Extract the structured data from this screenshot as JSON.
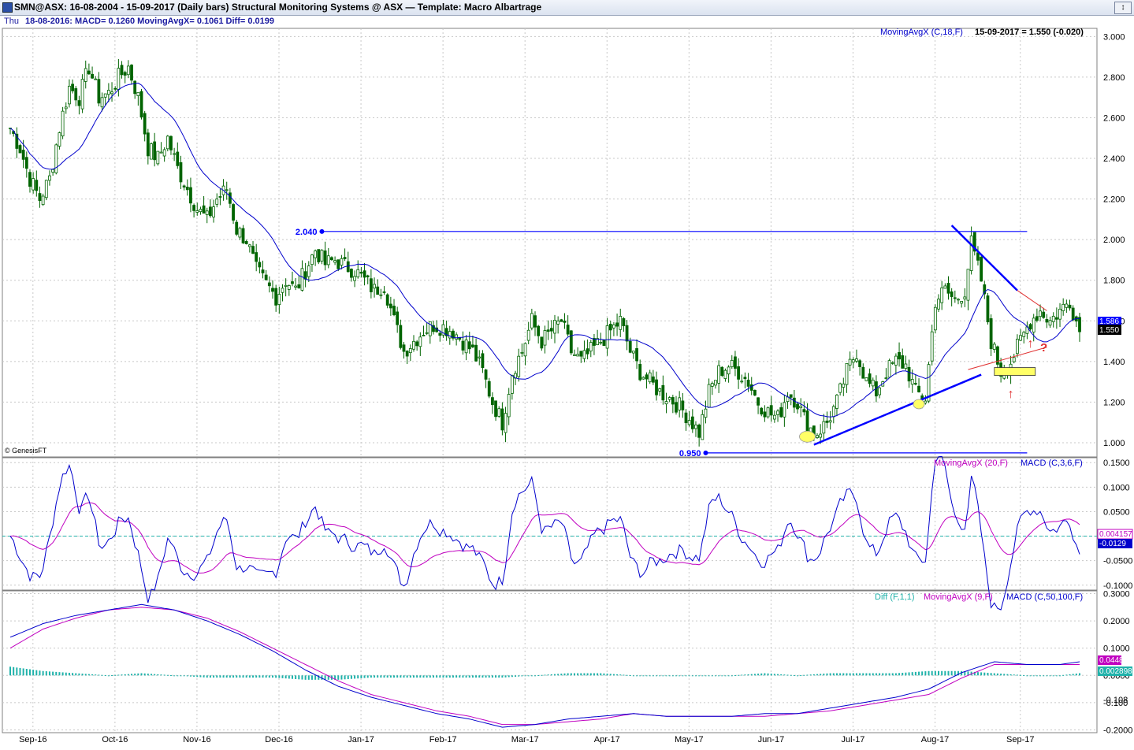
{
  "window": {
    "title": "SMN@ASX:  16-08-2004 - 15-09-2017  (Daily bars)   Structural Monitoring Systems @ ASX  —  Template: Macro Albartrage",
    "close_glyph": "↕"
  },
  "infobar": {
    "day": "Thu",
    "values": "18-08-2016:  MACD= 0.1260  MovingAvgX= 0.1061  Diff= 0.0199"
  },
  "colors": {
    "candle": "#006400",
    "ma": "#0000cc",
    "signal": "#c000c0",
    "diff": "#20b2aa",
    "trend": "#0000ff",
    "resistance": "#e03030",
    "axis_text": "#000000",
    "grid": "#c8c8c8",
    "highlight": "#ffff66"
  },
  "chart_data": [
    {
      "type": "candlestick",
      "panel": "price",
      "legend": [
        "MovingAvgX (C,18,F)",
        "15-09-2017 = 1.550 (-0.020)"
      ],
      "yticks": [
        "3.000",
        "2.800",
        "2.600",
        "2.400",
        "2.200",
        "2.000",
        "1.800",
        "1.600",
        "1.400",
        "1.200",
        "1.000"
      ],
      "ylim": [
        0.93,
        3.04
      ],
      "x_labels": [
        "Sep-16",
        "Oct-16",
        "Nov-16",
        "Dec-16",
        "Jan-17",
        "Feb-17",
        "Mar-17",
        "Apr-17",
        "May-17",
        "Jun-17",
        "Jul-17",
        "Aug-17",
        "Sep-17"
      ],
      "price_tags": [
        "1.586",
        "1.550"
      ],
      "annotations": {
        "high_label": "2.040",
        "low_label": "0.950",
        "question": "?",
        "watermark": "© GenesisFT"
      },
      "levels": {
        "high": 2.04,
        "low": 0.95
      },
      "trendlines": [
        {
          "name": "support",
          "from": [
            245,
            0.99
          ],
          "to": [
            296,
            1.335
          ]
        },
        {
          "name": "falling-resistance",
          "from": [
            287,
            2.07
          ],
          "to": [
            307,
            1.75
          ]
        },
        {
          "name": "red-resistance",
          "from": [
            307,
            1.75
          ],
          "to": [
            316,
            1.65
          ]
        },
        {
          "name": "red-support",
          "from": [
            292,
            1.36
          ],
          "to": [
            316,
            1.47
          ]
        }
      ],
      "close_path": [
        [
          0,
          2.55
        ],
        [
          3,
          2.45
        ],
        [
          6,
          2.3
        ],
        [
          9,
          2.2
        ],
        [
          12,
          2.3
        ],
        [
          15,
          2.55
        ],
        [
          18,
          2.75
        ],
        [
          21,
          2.7
        ],
        [
          24,
          2.85
        ],
        [
          27,
          2.7
        ],
        [
          30,
          2.72
        ],
        [
          33,
          2.8
        ],
        [
          36,
          2.85
        ],
        [
          39,
          2.7
        ],
        [
          42,
          2.45
        ],
        [
          45,
          2.4
        ],
        [
          48,
          2.5
        ],
        [
          51,
          2.35
        ],
        [
          54,
          2.25
        ],
        [
          57,
          2.15
        ],
        [
          60,
          2.1
        ],
        [
          63,
          2.2
        ],
        [
          66,
          2.25
        ],
        [
          69,
          2.05
        ],
        [
          72,
          2.0
        ],
        [
          75,
          1.85
        ],
        [
          78,
          1.78
        ],
        [
          81,
          1.72
        ],
        [
          84,
          1.8
        ],
        [
          87,
          1.75
        ],
        [
          90,
          1.85
        ],
        [
          93,
          1.95
        ],
        [
          96,
          1.88
        ],
        [
          99,
          1.9
        ],
        [
          102,
          1.87
        ],
        [
          105,
          1.85
        ],
        [
          108,
          1.8
        ],
        [
          111,
          1.75
        ],
        [
          114,
          1.78
        ],
        [
          117,
          1.6
        ],
        [
          120,
          1.45
        ],
        [
          123,
          1.5
        ],
        [
          126,
          1.55
        ],
        [
          129,
          1.58
        ],
        [
          132,
          1.57
        ],
        [
          135,
          1.55
        ],
        [
          138,
          1.5
        ],
        [
          141,
          1.45
        ],
        [
          144,
          1.35
        ],
        [
          147,
          1.2
        ],
        [
          150,
          1.1
        ],
        [
          153,
          1.35
        ],
        [
          156,
          1.45
        ],
        [
          159,
          1.6
        ],
        [
          162,
          1.5
        ],
        [
          165,
          1.55
        ],
        [
          168,
          1.6
        ],
        [
          171,
          1.45
        ],
        [
          174,
          1.4
        ],
        [
          177,
          1.45
        ],
        [
          180,
          1.5
        ],
        [
          183,
          1.55
        ],
        [
          186,
          1.6
        ],
        [
          189,
          1.45
        ],
        [
          192,
          1.35
        ],
        [
          195,
          1.3
        ],
        [
          198,
          1.25
        ],
        [
          201,
          1.22
        ],
        [
          204,
          1.18
        ],
        [
          207,
          1.12
        ],
        [
          210,
          1.05
        ],
        [
          213,
          1.25
        ],
        [
          216,
          1.35
        ],
        [
          219,
          1.38
        ],
        [
          222,
          1.35
        ],
        [
          225,
          1.3
        ],
        [
          228,
          1.2
        ],
        [
          231,
          1.15
        ],
        [
          234,
          1.12
        ],
        [
          237,
          1.25
        ],
        [
          240,
          1.2
        ],
        [
          243,
          1.08
        ],
        [
          246,
          1.05
        ],
        [
          249,
          1.1
        ],
        [
          252,
          1.2
        ],
        [
          255,
          1.35
        ],
        [
          258,
          1.45
        ],
        [
          261,
          1.3
        ],
        [
          264,
          1.25
        ],
        [
          267,
          1.35
        ],
        [
          270,
          1.4
        ],
        [
          273,
          1.38
        ],
        [
          276,
          1.25
        ],
        [
          279,
          1.22
        ],
        [
          282,
          1.7
        ],
        [
          285,
          1.75
        ],
        [
          288,
          1.7
        ],
        [
          291,
          1.75
        ],
        [
          293,
          1.98
        ],
        [
          296,
          1.8
        ],
        [
          299,
          1.5
        ],
        [
          302,
          1.35
        ],
        [
          305,
          1.4
        ],
        [
          308,
          1.5
        ],
        [
          311,
          1.6
        ],
        [
          314,
          1.65
        ],
        [
          317,
          1.6
        ],
        [
          320,
          1.65
        ],
        [
          323,
          1.7
        ],
        [
          326,
          1.55
        ]
      ]
    },
    {
      "type": "line",
      "panel": "macd-fast",
      "legend": [
        "MovingAvgX (20,F)",
        "MACD (C,3,6,F)"
      ],
      "yticks": [
        "0.1500",
        "0.1000",
        "0.0500",
        "0.0000",
        "-0.0500",
        "-0.1000"
      ],
      "ylim": [
        -0.11,
        0.16
      ],
      "tags": [
        "0.004157",
        "-0.0129"
      ],
      "zero_line": 0.0
    },
    {
      "type": "line",
      "panel": "macd-slow",
      "legend": [
        "Diff (F,1,1)",
        "MovingAvgX (9,F)",
        "MACD (C,50,100,F)"
      ],
      "yticks": [
        "0.3000",
        "0.2000",
        "0.1000",
        "0.0000",
        "-0.100",
        "-0.2000"
      ],
      "ylim": [
        -0.21,
        0.31
      ],
      "tags": [
        "0.0448",
        "0.002898",
        "-0.108"
      ],
      "macd_path": [
        [
          0,
          0.14
        ],
        [
          10,
          0.19
        ],
        [
          20,
          0.22
        ],
        [
          30,
          0.24
        ],
        [
          40,
          0.26
        ],
        [
          50,
          0.24
        ],
        [
          60,
          0.2
        ],
        [
          70,
          0.15
        ],
        [
          80,
          0.09
        ],
        [
          90,
          0.02
        ],
        [
          100,
          -0.04
        ],
        [
          110,
          -0.08
        ],
        [
          120,
          -0.11
        ],
        [
          130,
          -0.14
        ],
        [
          140,
          -0.16
        ],
        [
          150,
          -0.19
        ],
        [
          160,
          -0.18
        ],
        [
          170,
          -0.16
        ],
        [
          180,
          -0.15
        ],
        [
          190,
          -0.14
        ],
        [
          200,
          -0.15
        ],
        [
          210,
          -0.15
        ],
        [
          220,
          -0.15
        ],
        [
          230,
          -0.14
        ],
        [
          240,
          -0.14
        ],
        [
          250,
          -0.12
        ],
        [
          260,
          -0.1
        ],
        [
          270,
          -0.08
        ],
        [
          280,
          -0.05
        ],
        [
          290,
          0.01
        ],
        [
          300,
          0.05
        ],
        [
          310,
          0.04
        ],
        [
          320,
          0.04
        ],
        [
          326,
          0.05
        ]
      ],
      "signal_path": [
        [
          0,
          0.1
        ],
        [
          10,
          0.17
        ],
        [
          20,
          0.21
        ],
        [
          30,
          0.24
        ],
        [
          40,
          0.25
        ],
        [
          50,
          0.24
        ],
        [
          60,
          0.21
        ],
        [
          70,
          0.16
        ],
        [
          80,
          0.1
        ],
        [
          90,
          0.04
        ],
        [
          100,
          -0.02
        ],
        [
          110,
          -0.07
        ],
        [
          120,
          -0.1
        ],
        [
          130,
          -0.13
        ],
        [
          140,
          -0.15
        ],
        [
          150,
          -0.18
        ],
        [
          160,
          -0.18
        ],
        [
          170,
          -0.17
        ],
        [
          180,
          -0.16
        ],
        [
          190,
          -0.14
        ],
        [
          200,
          -0.15
        ],
        [
          210,
          -0.15
        ],
        [
          220,
          -0.15
        ],
        [
          230,
          -0.15
        ],
        [
          240,
          -0.14
        ],
        [
          250,
          -0.13
        ],
        [
          260,
          -0.11
        ],
        [
          270,
          -0.09
        ],
        [
          280,
          -0.07
        ],
        [
          290,
          -0.01
        ],
        [
          300,
          0.04
        ],
        [
          310,
          0.04
        ],
        [
          320,
          0.04
        ],
        [
          326,
          0.04
        ]
      ]
    }
  ]
}
